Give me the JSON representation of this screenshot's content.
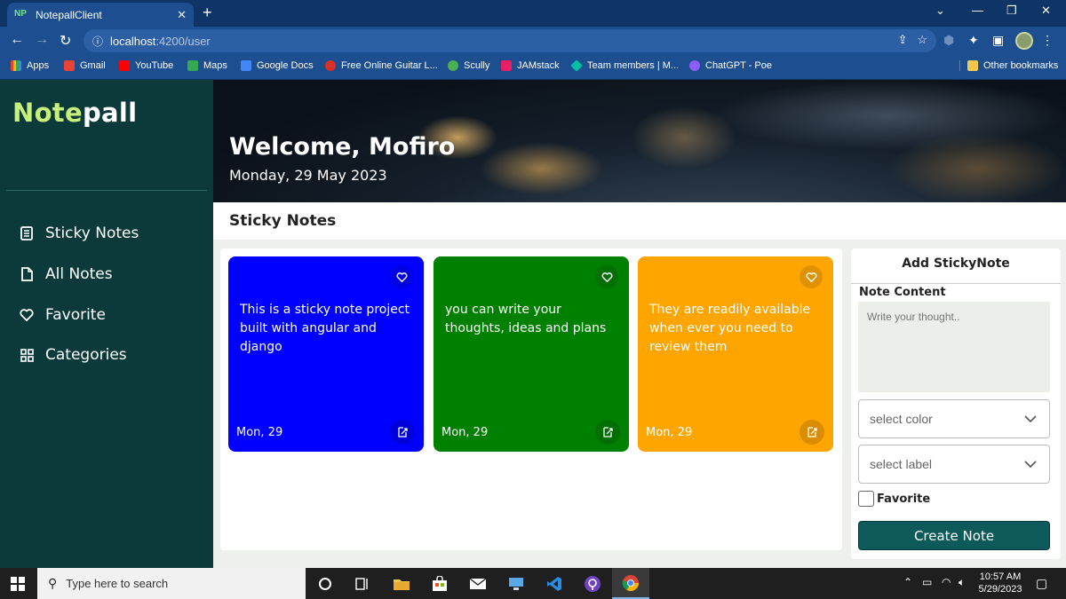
{
  "browser": {
    "tab_title": "NotepallClient",
    "tab_favicon": "NP",
    "url_host": "localhost",
    "url_path": ":4200/user",
    "bookmarks": [
      {
        "label": "Apps",
        "color": "#e94235"
      },
      {
        "label": "Gmail",
        "color": "#ea4335"
      },
      {
        "label": "YouTube",
        "color": "#ff0000"
      },
      {
        "label": "Maps",
        "color": "#34a853"
      },
      {
        "label": "Google Docs",
        "color": "#4285f4"
      },
      {
        "label": "Free Online Guitar L...",
        "color": "#d93025"
      },
      {
        "label": "Scully",
        "color": "#4caf50"
      },
      {
        "label": "JAMstack",
        "color": "#e91e63"
      },
      {
        "label": "Team members | M...",
        "color": "#00bfa5"
      },
      {
        "label": "ChatGPT - Poe",
        "color": "#8e5cf6"
      }
    ],
    "other_bookmarks": "Other bookmarks"
  },
  "app": {
    "logo_highlight": "Note",
    "logo_rest": "pall",
    "nav": [
      {
        "label": "Sticky Notes",
        "icon": "list-icon"
      },
      {
        "label": "All Notes",
        "icon": "file-icon"
      },
      {
        "label": "Favorite",
        "icon": "heart-icon"
      },
      {
        "label": "Categories",
        "icon": "grid-icon"
      }
    ],
    "welcome": "Welcome, Mofiro",
    "date": "Monday, 29 May 2023",
    "section_title": "Sticky Notes",
    "notes": [
      {
        "text": "This is a sticky note project built with angular and django",
        "date": "Mon, 29",
        "color": "#0000ff"
      },
      {
        "text": "you can write your thoughts,  ideas and plans",
        "date": "Mon, 29",
        "color": "#008000"
      },
      {
        "text": "They are readily available when ever you need to review them",
        "date": "Mon, 29",
        "color": "#ffa500"
      }
    ],
    "add_form": {
      "title": "Add StickyNote",
      "content_label": "Note Content",
      "content_placeholder": "Write your thought..",
      "color_select": "select color",
      "label_select": "select label",
      "favorite_label": "Favorite",
      "submit": "Create Note"
    },
    "colors": {
      "sidebar": "#0c3a3a",
      "accent": "#c7f07a",
      "button": "#0e5a5a"
    }
  },
  "taskbar": {
    "search_placeholder": "Type here to search",
    "time": "10:57 AM",
    "date": "5/29/2023"
  }
}
